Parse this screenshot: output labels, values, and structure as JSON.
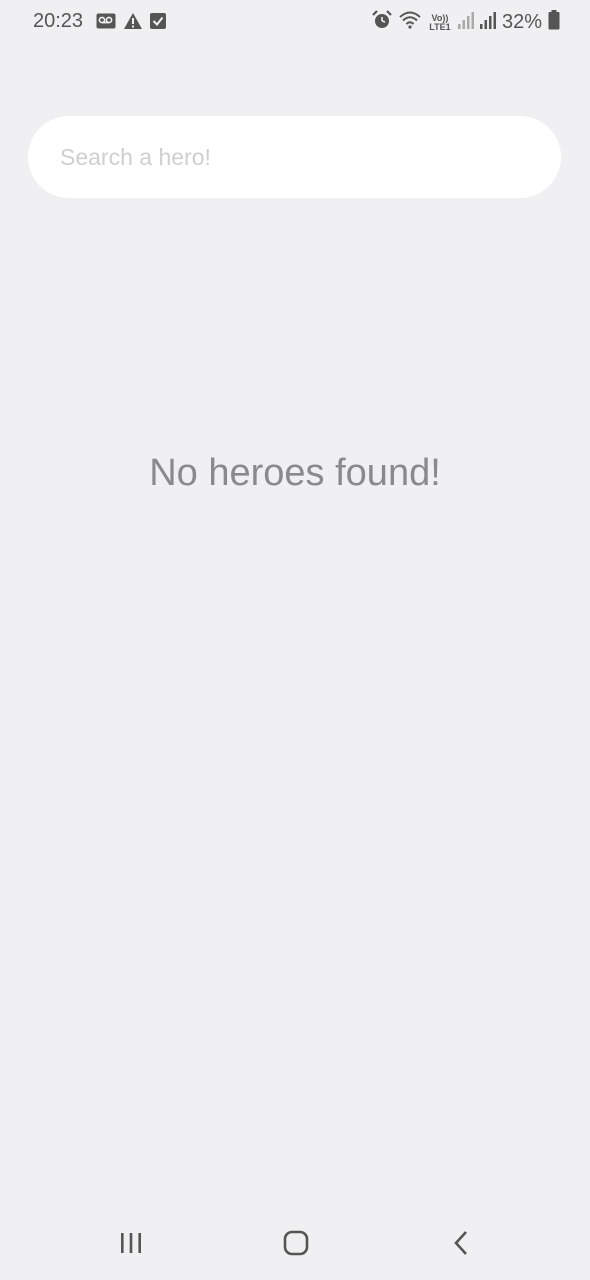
{
  "status_bar": {
    "time": "20:23",
    "left_icons": [
      "voicemail-icon",
      "warning-icon",
      "checkbox-icon"
    ],
    "right_icons": [
      "alarm-icon",
      "wifi-icon",
      "volte-lte-icon",
      "signal-icon",
      "signal-icon",
      "battery-icon"
    ],
    "network_label_top": "Vo))",
    "network_label_bottom": "LTE1",
    "battery": "32%"
  },
  "search": {
    "placeholder": "Search a hero!",
    "value": ""
  },
  "empty_state": {
    "message": "No heroes found!"
  },
  "nav_bar": {
    "icons": [
      "recent-apps-icon",
      "home-icon",
      "back-icon"
    ]
  }
}
